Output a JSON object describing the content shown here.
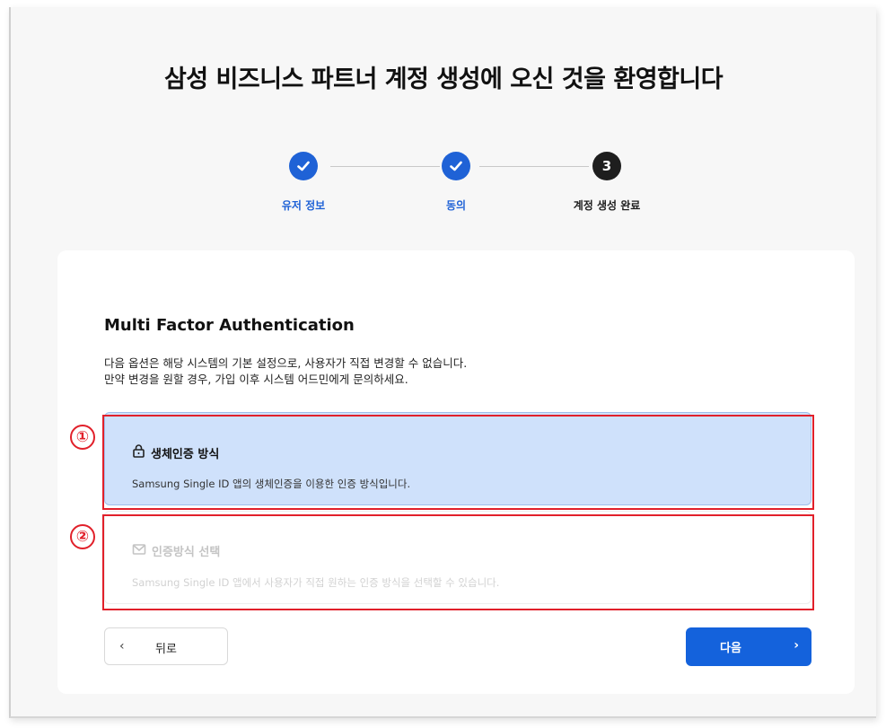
{
  "page": {
    "title": "삼성 비즈니스 파트너 계정 생성에 오신 것을 환영합니다"
  },
  "stepper": {
    "steps": [
      {
        "label": "유저 정보",
        "state": "done",
        "icon": "check-icon"
      },
      {
        "label": "동의",
        "state": "done",
        "icon": "check-icon"
      },
      {
        "label": "계정 생성 완료",
        "state": "current",
        "number": "3"
      }
    ]
  },
  "card": {
    "section_title": "Multi Factor Authentication",
    "description_line1": "다음 옵션은 해당 시스템의 기본 설정으로, 사용자가 직접 변경할 수 없습니다.",
    "description_line2": "만약 변경을 원할 경우, 가입 이후 시스템 어드민에게 문의하세요.",
    "options": [
      {
        "icon": "lock-icon",
        "title": "생체인증 방식",
        "description": "Samsung Single ID 앱의 생체인증을 이용한 인증 방식입니다.",
        "state": "selected"
      },
      {
        "icon": "mail-icon",
        "title": "인증방식 선택",
        "description": "Samsung Single ID 앱에서 사용자가 직접 원하는 인증 방식을 선택할 수 있습니다.",
        "state": "disabled"
      }
    ],
    "annotations": [
      "①",
      "②"
    ]
  },
  "buttons": {
    "back_label": "뒤로",
    "back_icon": "chevron-left-icon",
    "next_label": "다음",
    "next_icon": "chevron-right-icon"
  },
  "colors": {
    "accent": "#1462dc",
    "selected_bg": "#cfe1fb",
    "annotation": "#e1202a",
    "background": "#f7f7f7"
  }
}
